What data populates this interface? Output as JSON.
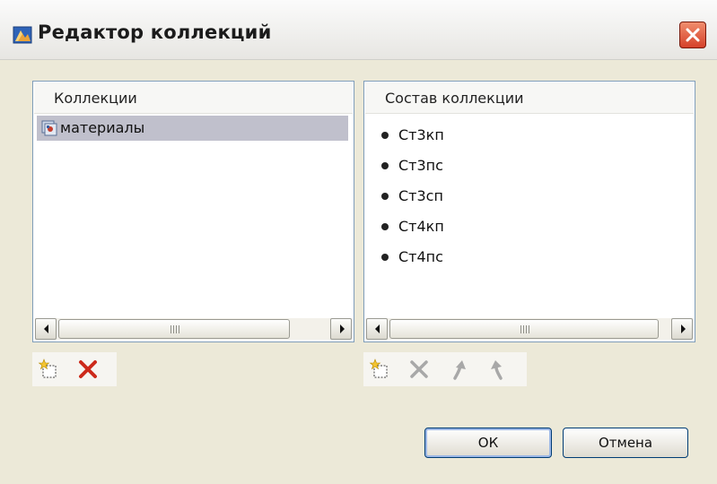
{
  "window": {
    "title": "Редактор коллекций"
  },
  "collections_panel": {
    "header": "Коллекции",
    "items": [
      {
        "label": "материалы",
        "selected": true
      }
    ]
  },
  "contents_panel": {
    "header": "Состав коллекции",
    "items": [
      "Ст3кп",
      "Ст3пс",
      "Ст3сп",
      "Ст4кп",
      "Ст4пс"
    ]
  },
  "collections_toolbar": {
    "buttons": [
      "new-icon",
      "delete-icon"
    ]
  },
  "contents_toolbar": {
    "buttons": [
      "new-icon",
      "delete-icon",
      "move-up-icon",
      "move-down-icon"
    ]
  },
  "buttons": {
    "ok": "ОК",
    "cancel": "Отмена"
  },
  "colors": {
    "selection": "#c0c0cc",
    "panel_border": "#7f9db9",
    "close_button": "#d5412a",
    "delete_active": "#cc2a1b",
    "disabled": "#a8a8a8"
  }
}
